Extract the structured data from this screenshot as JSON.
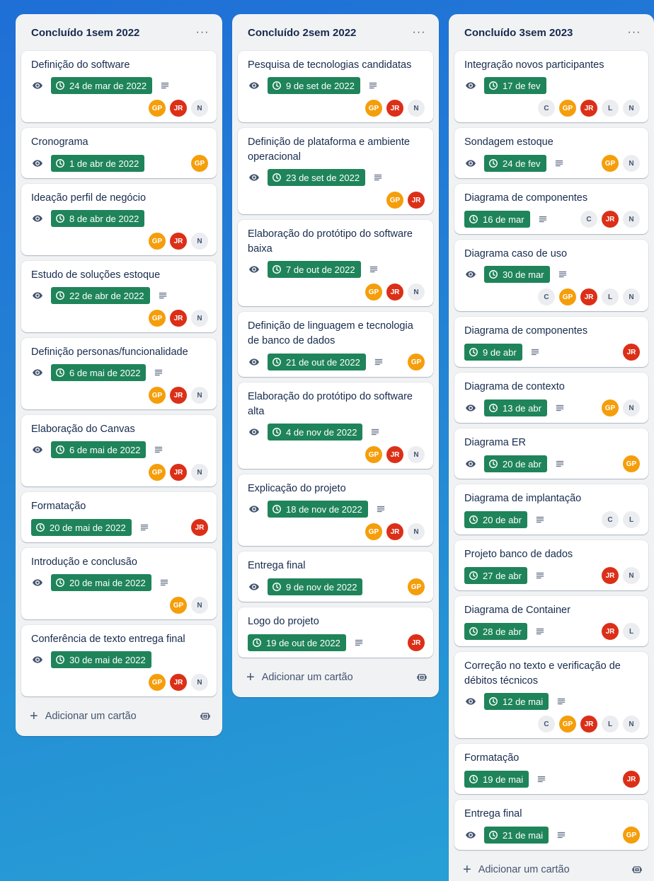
{
  "lists": [
    {
      "title": "Concluído 1sem 2022",
      "menu": "···",
      "add_label": "Adicionar um cartão",
      "cards": [
        {
          "title": "Definição do software",
          "watched": true,
          "date": "24 de mar de 2022",
          "description": true,
          "members": [
            "GP",
            "JR",
            "N"
          ],
          "members_below": true
        },
        {
          "title": "Cronograma",
          "watched": true,
          "date": "1 de abr de 2022",
          "description": false,
          "members": [
            "GP"
          ],
          "members_below": false
        },
        {
          "title": "Ideação perfil de negócio",
          "watched": true,
          "date": "8 de abr de 2022",
          "description": false,
          "members": [
            "GP",
            "JR",
            "N"
          ],
          "members_below": true
        },
        {
          "title": "Estudo de soluções estoque",
          "watched": true,
          "date": "22 de abr de 2022",
          "description": true,
          "members": [
            "GP",
            "JR",
            "N"
          ],
          "members_below": true
        },
        {
          "title": "Definição personas/funcionalidade",
          "watched": true,
          "date": "6 de mai de 2022",
          "description": true,
          "members": [
            "GP",
            "JR",
            "N"
          ],
          "members_below": true
        },
        {
          "title": "Elaboração do Canvas",
          "watched": true,
          "date": "6 de mai de 2022",
          "description": true,
          "members": [
            "GP",
            "JR",
            "N"
          ],
          "members_below": true
        },
        {
          "title": "Formatação",
          "watched": false,
          "date": "20 de mai de 2022",
          "description": true,
          "members": [
            "JR"
          ],
          "members_below": false
        },
        {
          "title": "Introdução e conclusão",
          "watched": true,
          "date": "20 de mai de 2022",
          "description": true,
          "members": [
            "GP",
            "N"
          ],
          "members_below": true
        },
        {
          "title": "Conferência de texto entrega final",
          "watched": true,
          "date": "30 de mai de 2022",
          "description": false,
          "members": [
            "GP",
            "JR",
            "N"
          ],
          "members_below": true
        }
      ]
    },
    {
      "title": "Concluído 2sem 2022",
      "menu": "···",
      "add_label": "Adicionar um cartão",
      "cards": [
        {
          "title": "Pesquisa de tecnologias candidatas",
          "watched": true,
          "date": "9 de set de 2022",
          "description": true,
          "members": [
            "GP",
            "JR",
            "N"
          ],
          "members_below": true
        },
        {
          "title": "Definição de plataforma e ambiente operacional",
          "watched": true,
          "date": "23 de set de 2022",
          "description": true,
          "members": [
            "GP",
            "JR"
          ],
          "members_below": true
        },
        {
          "title": "Elaboração do protótipo do software baixa",
          "watched": true,
          "date": "7 de out de 2022",
          "description": true,
          "members": [
            "GP",
            "JR",
            "N"
          ],
          "members_below": true
        },
        {
          "title": "Definição de linguagem e tecnologia de banco de dados",
          "watched": true,
          "date": "21 de out de 2022",
          "description": true,
          "members": [
            "GP"
          ],
          "members_below": false
        },
        {
          "title": "Elaboração do protótipo do software alta",
          "watched": true,
          "date": "4 de nov de 2022",
          "description": true,
          "members": [
            "GP",
            "JR",
            "N"
          ],
          "members_below": true
        },
        {
          "title": "Explicação do projeto",
          "watched": true,
          "date": "18 de nov de 2022",
          "description": true,
          "members": [
            "GP",
            "JR",
            "N"
          ],
          "members_below": true
        },
        {
          "title": "Entrega final",
          "watched": true,
          "date": "9 de nov de 2022",
          "description": false,
          "members": [
            "GP"
          ],
          "members_below": false
        },
        {
          "title": "Logo do projeto",
          "watched": false,
          "date": "19 de out de 2022",
          "description": true,
          "members": [
            "JR"
          ],
          "members_below": false
        }
      ]
    },
    {
      "title": "Concluído 3sem 2023",
      "menu": "···",
      "add_label": "Adicionar um cartão",
      "cards": [
        {
          "title": "Integração novos participantes",
          "watched": true,
          "date": "17 de fev",
          "description": false,
          "members": [
            "C",
            "GP",
            "JR",
            "L",
            "N"
          ],
          "members_below": true
        },
        {
          "title": "Sondagem estoque",
          "watched": true,
          "date": "24 de fev",
          "description": true,
          "members": [
            "GP",
            "N"
          ],
          "members_below": false
        },
        {
          "title": "Diagrama de componentes",
          "watched": false,
          "date": "16 de mar",
          "description": true,
          "members": [
            "C",
            "JR",
            "N"
          ],
          "members_below": false
        },
        {
          "title": "Diagrama caso de uso",
          "watched": true,
          "date": "30 de mar",
          "description": true,
          "members": [
            "C",
            "GP",
            "JR",
            "L",
            "N"
          ],
          "members_below": true
        },
        {
          "title": "Diagrama de componentes",
          "watched": false,
          "date": "9 de abr",
          "description": true,
          "members": [
            "JR"
          ],
          "members_below": false
        },
        {
          "title": "Diagrama de contexto",
          "watched": true,
          "date": "13 de abr",
          "description": true,
          "members": [
            "GP",
            "N"
          ],
          "members_below": false
        },
        {
          "title": "Diagrama ER",
          "watched": true,
          "date": "20 de abr",
          "description": true,
          "members": [
            "GP"
          ],
          "members_below": false
        },
        {
          "title": "Diagrama de implantação",
          "watched": false,
          "date": "20 de abr",
          "description": true,
          "members": [
            "C",
            "L"
          ],
          "members_below": false
        },
        {
          "title": "Projeto banco de dados",
          "watched": false,
          "date": "27 de abr",
          "description": true,
          "members": [
            "JR",
            "N"
          ],
          "members_below": false
        },
        {
          "title": "Diagrama de Container",
          "watched": false,
          "date": "28 de abr",
          "description": true,
          "members": [
            "JR",
            "L"
          ],
          "members_below": false
        },
        {
          "title": "Correção no texto e verificação de débitos técnicos",
          "watched": true,
          "date": "12 de mai",
          "description": true,
          "members": [
            "C",
            "GP",
            "JR",
            "L",
            "N"
          ],
          "members_below": true
        },
        {
          "title": "Formatação",
          "watched": false,
          "date": "19 de mai",
          "description": true,
          "members": [
            "JR"
          ],
          "members_below": false
        },
        {
          "title": "Entrega final",
          "watched": true,
          "date": "21 de mai",
          "description": true,
          "members": [
            "GP"
          ],
          "members_below": false
        }
      ]
    }
  ],
  "icons": {
    "watch": "eye-icon",
    "due": "clock-icon",
    "description": "description-icon",
    "add": "plus-icon",
    "template": "card-template-icon"
  },
  "colors": {
    "due_complete": "#1f845a",
    "avatar_gp": "#f59e0b",
    "avatar_jr": "#dc2f18",
    "avatar_neutral": "#ebedf0"
  }
}
